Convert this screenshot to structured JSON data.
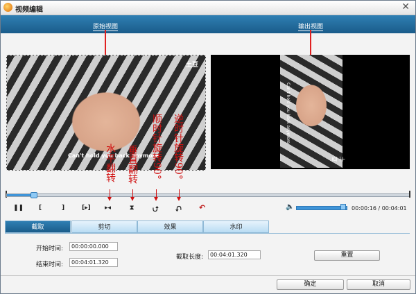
{
  "window": {
    "title": "视频编辑"
  },
  "views": {
    "original_label": "原始视图",
    "output_label": "输出视图"
  },
  "preview": {
    "watermark": "土豆",
    "subtitle": "Can't hold you back anymore"
  },
  "controls": {
    "play_pause": "❚❚",
    "mark_in": "[",
    "mark_out": "]",
    "next": "[▸]",
    "flip_h": "▸◂",
    "flip_v": "⧗",
    "rotate_cw": "⮍",
    "rotate_ccw": "⮏",
    "undo": "↶",
    "volume_icon": "🔈",
    "time": "00:00:16 / 00:04:01"
  },
  "annotations": {
    "flip_h": "水平翻转",
    "flip_v": "垂直翻转",
    "rotate_cw": "顺时针旋转90°",
    "rotate_ccw": "逆时针旋转90°"
  },
  "tabs": [
    "截取",
    "剪切",
    "效果",
    "水印"
  ],
  "trim": {
    "start_label": "开始时间:",
    "start_value": "00:00:00.000",
    "end_label": "结束时间:",
    "end_value": "00:04:01.320",
    "length_label": "截取长度:",
    "length_value": "00:04:01.320",
    "reset_label": "重置"
  },
  "footer": {
    "ok_label": "确定",
    "cancel_label": "取消"
  },
  "progress": {
    "seek_fraction": 0.066,
    "volume_fraction": 0.95
  }
}
